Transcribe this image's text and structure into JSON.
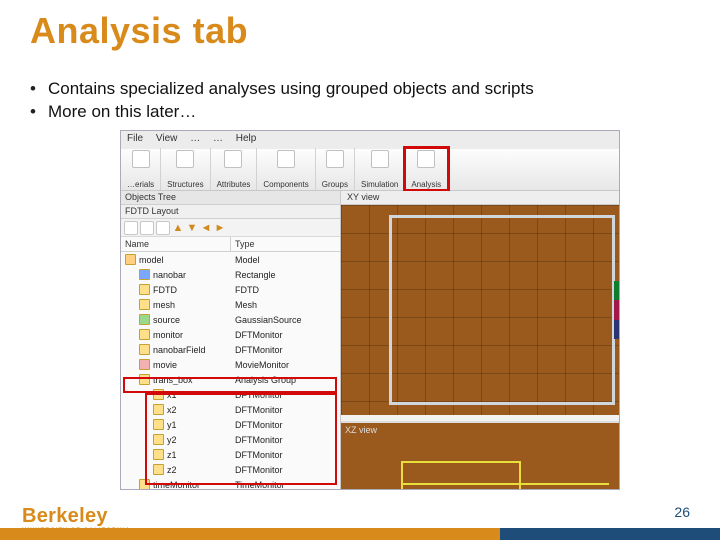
{
  "title": "Analysis tab",
  "bullets": [
    "Contains specialized analyses using grouped objects and scripts",
    "More on this later…"
  ],
  "menubar": [
    "File",
    "View",
    "…",
    "…",
    "Help"
  ],
  "ribbon": [
    {
      "label": "…erials"
    },
    {
      "label": "Structures"
    },
    {
      "label": "Attributes"
    },
    {
      "label": "Components"
    },
    {
      "label": "Groups"
    },
    {
      "label": "Simulation"
    },
    {
      "label": "Analysis",
      "highlight": true
    }
  ],
  "tree": {
    "panel_title": "Objects Tree",
    "root": "FDTD Layout",
    "cols": [
      "Name",
      "Type"
    ],
    "rows": [
      {
        "name": "model",
        "type": "Model",
        "cls": "model",
        "depth": 0
      },
      {
        "name": "nanobar",
        "type": "Rectangle",
        "cls": "blue",
        "depth": 1
      },
      {
        "name": "FDTD",
        "type": "FDTD",
        "cls": "",
        "depth": 1
      },
      {
        "name": "mesh",
        "type": "Mesh",
        "cls": "",
        "depth": 1
      },
      {
        "name": "source",
        "type": "GaussianSource",
        "cls": "green",
        "depth": 1
      },
      {
        "name": "monitor",
        "type": "DFTMonitor",
        "cls": "",
        "depth": 1
      },
      {
        "name": "nanobarField",
        "type": "DFTMonitor",
        "cls": "",
        "depth": 1
      },
      {
        "name": "movie",
        "type": "MovieMonitor",
        "cls": "pink",
        "depth": 1
      },
      {
        "name": "trans_box",
        "type": "Analysis Group",
        "cls": "",
        "depth": 1
      },
      {
        "name": "x1",
        "type": "DFTMonitor",
        "cls": "",
        "depth": 2
      },
      {
        "name": "x2",
        "type": "DFTMonitor",
        "cls": "",
        "depth": 2
      },
      {
        "name": "y1",
        "type": "DFTMonitor",
        "cls": "",
        "depth": 2
      },
      {
        "name": "y2",
        "type": "DFTMonitor",
        "cls": "",
        "depth": 2
      },
      {
        "name": "z1",
        "type": "DFTMonitor",
        "cls": "",
        "depth": 2
      },
      {
        "name": "z2",
        "type": "DFTMonitor",
        "cls": "",
        "depth": 2
      },
      {
        "name": "timeMonitor",
        "type": "TimeMonitor",
        "cls": "",
        "depth": 1
      }
    ]
  },
  "views": {
    "xy": "XY view",
    "xz": "XZ view"
  },
  "logo": {
    "name": "Berkeley",
    "sub": "UNIVERSITY OF CALIFORNIA"
  },
  "page_number": "26"
}
